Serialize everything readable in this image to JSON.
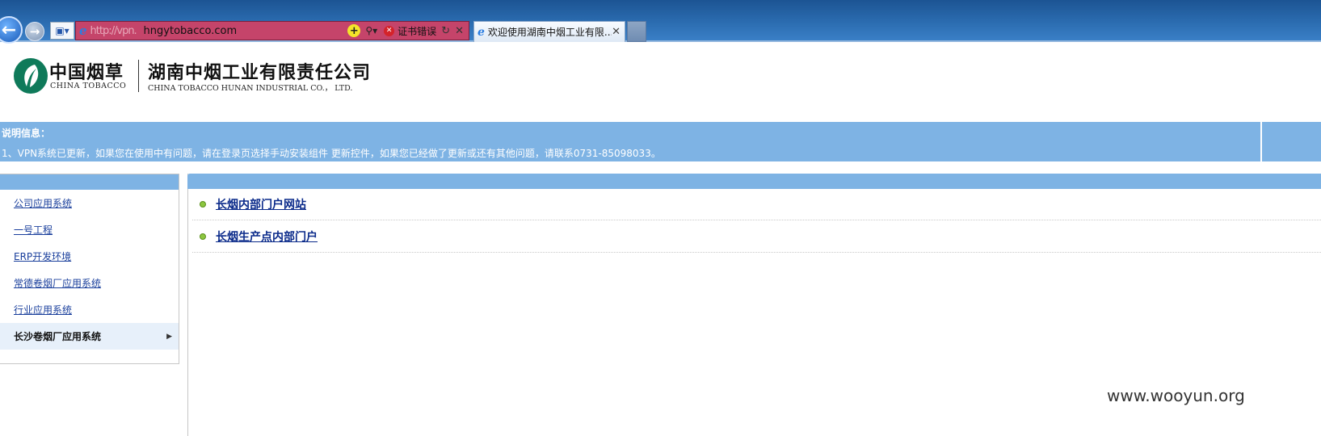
{
  "browser": {
    "url_blur": "http://vpn.",
    "url_domain": "hngytobacco.com",
    "cert_error": "证书错误",
    "tab_title": "欢迎使用湖南中烟工业有限...",
    "icons": [
      "back-icon",
      "forward-icon",
      "site-identity-icon",
      "ie-icon",
      "add-icon",
      "search-icon",
      "cert-error-icon",
      "refresh-icon",
      "stop-icon",
      "tab-close-icon"
    ]
  },
  "header": {
    "brand_cn": "中国烟草",
    "brand_en": "CHINA TOBACCO",
    "company_cn": "湖南中烟工业有限责任公司",
    "company_en": "CHINA TOBACCO HUNAN INDUSTRIAL CO.， LTD."
  },
  "notice": {
    "title": "说明信息：",
    "text": "1、VPN系统已更新，如果您在使用中有问题，请在登录页选择手动安装组件 更新控件，如果您已经做了更新或还有其他问题，请联系0731-85098033。"
  },
  "sidebar": {
    "items": [
      {
        "label": "公司应用系统"
      },
      {
        "label": "一号工程"
      },
      {
        "label": "ERP开发环境"
      },
      {
        "label": "常德卷烟厂应用系统"
      },
      {
        "label": "行业应用系统"
      },
      {
        "label": "长沙卷烟厂应用系统"
      }
    ]
  },
  "main": {
    "links": [
      {
        "label": "长烟内部门户网站"
      },
      {
        "label": "长烟生产点内部门户"
      }
    ]
  },
  "watermark": "www.wooyun.org",
  "colors": {
    "bar": "#7eb3e4",
    "link": "#1a3f9c",
    "bullet": "#8cc63f",
    "logo": "#0f7a5a"
  }
}
